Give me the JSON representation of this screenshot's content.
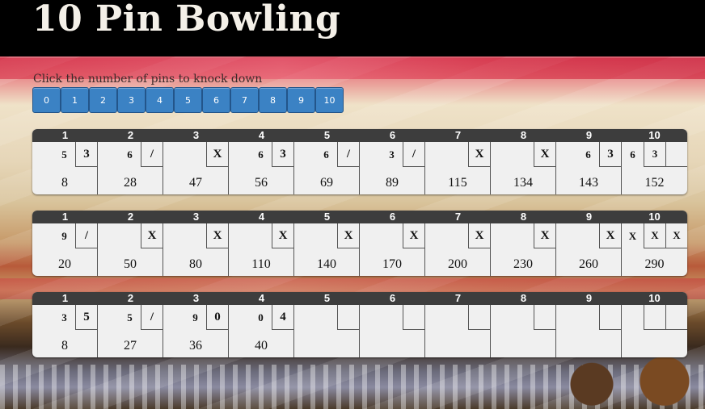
{
  "title": "10 Pin Bowling",
  "instructions": "Click the number of pins to knock down",
  "pin_buttons": [
    "0",
    "1",
    "2",
    "3",
    "4",
    "5",
    "6",
    "7",
    "8",
    "9",
    "10"
  ],
  "frame_numbers": [
    "1",
    "2",
    "3",
    "4",
    "5",
    "6",
    "7",
    "8",
    "9",
    "10"
  ],
  "games": [
    {
      "frames": [
        {
          "r1": "5",
          "r2": "3",
          "score": "8"
        },
        {
          "r1": "6",
          "r2": "/",
          "score": "28"
        },
        {
          "r1": "",
          "r2": "X",
          "score": "47"
        },
        {
          "r1": "6",
          "r2": "3",
          "score": "56"
        },
        {
          "r1": "6",
          "r2": "/",
          "score": "69"
        },
        {
          "r1": "3",
          "r2": "/",
          "score": "89"
        },
        {
          "r1": "",
          "r2": "X",
          "score": "115"
        },
        {
          "r1": "",
          "r2": "X",
          "score": "134"
        },
        {
          "r1": "6",
          "r2": "3",
          "score": "143"
        },
        {
          "r1": "6",
          "r2": "3",
          "r3": "",
          "score": "152"
        }
      ]
    },
    {
      "frames": [
        {
          "r1": "9",
          "r2": "/",
          "score": "20"
        },
        {
          "r1": "",
          "r2": "X",
          "score": "50"
        },
        {
          "r1": "",
          "r2": "X",
          "score": "80"
        },
        {
          "r1": "",
          "r2": "X",
          "score": "110"
        },
        {
          "r1": "",
          "r2": "X",
          "score": "140"
        },
        {
          "r1": "",
          "r2": "X",
          "score": "170"
        },
        {
          "r1": "",
          "r2": "X",
          "score": "200"
        },
        {
          "r1": "",
          "r2": "X",
          "score": "230"
        },
        {
          "r1": "",
          "r2": "X",
          "score": "260"
        },
        {
          "r1": "X",
          "r2": "X",
          "r3": "X",
          "score": "290"
        }
      ]
    },
    {
      "frames": [
        {
          "r1": "3",
          "r2": "5",
          "score": "8"
        },
        {
          "r1": "5",
          "r2": "/",
          "score": "27"
        },
        {
          "r1": "9",
          "r2": "0",
          "score": "36"
        },
        {
          "r1": "0",
          "r2": "4",
          "score": "40"
        },
        {
          "r1": "",
          "r2": "",
          "score": ""
        },
        {
          "r1": "",
          "r2": "",
          "score": ""
        },
        {
          "r1": "",
          "r2": "",
          "score": ""
        },
        {
          "r1": "",
          "r2": "",
          "score": ""
        },
        {
          "r1": "",
          "r2": "",
          "score": ""
        },
        {
          "r1": "",
          "r2": "",
          "r3": "",
          "score": ""
        }
      ]
    }
  ]
}
